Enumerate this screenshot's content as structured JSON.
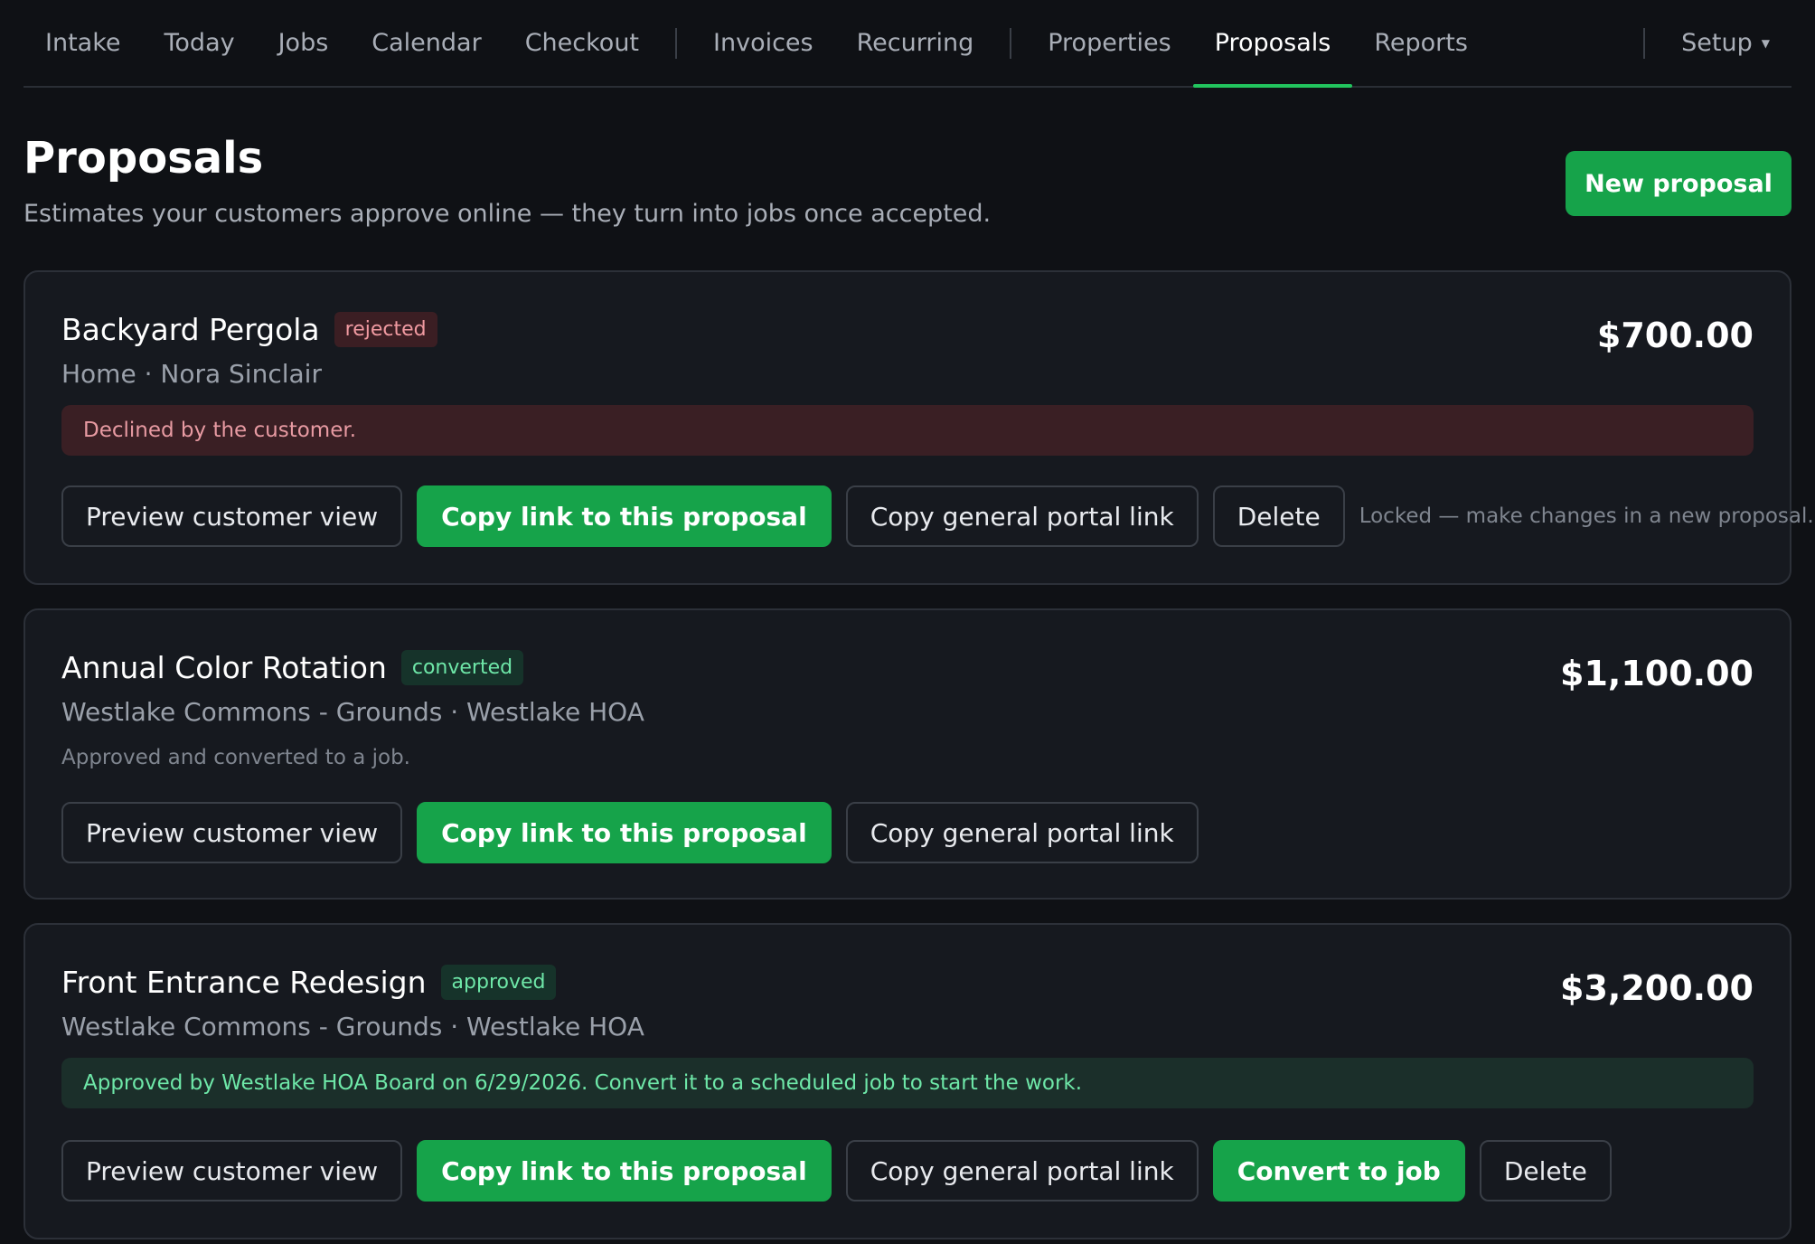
{
  "nav": {
    "items": [
      {
        "label": "Intake"
      },
      {
        "label": "Today"
      },
      {
        "label": "Jobs"
      },
      {
        "label": "Calendar"
      },
      {
        "label": "Checkout"
      },
      {
        "label": "Invoices"
      },
      {
        "label": "Recurring"
      },
      {
        "label": "Properties"
      },
      {
        "label": "Proposals",
        "active": true
      },
      {
        "label": "Reports"
      }
    ],
    "setup_label": "Setup",
    "accent_color": "#22c55e"
  },
  "header": {
    "title": "Proposals",
    "subtitle": "Estimates your customers approve online — they turn into jobs once accepted.",
    "new_button": "New proposal"
  },
  "proposals": [
    {
      "title": "Backyard Pergola",
      "status": "rejected",
      "amount": "$700.00",
      "subtitle": "Home · Nora Sinclair",
      "banner": "Declined by the customer.",
      "actions": {
        "preview": "Preview customer view",
        "copy_link": "Copy link to this proposal",
        "copy_portal": "Copy general portal link",
        "delete": "Delete"
      },
      "lock_note": "Locked — make changes in a new proposal."
    },
    {
      "title": "Annual Color Rotation",
      "status": "converted",
      "amount": "$1,100.00",
      "subtitle": "Westlake Commons - Grounds · Westlake HOA",
      "note": "Approved and converted to a job.",
      "actions": {
        "preview": "Preview customer view",
        "copy_link": "Copy link to this proposal",
        "copy_portal": "Copy general portal link"
      }
    },
    {
      "title": "Front Entrance Redesign",
      "status": "approved",
      "amount": "$3,200.00",
      "subtitle": "Westlake Commons - Grounds · Westlake HOA",
      "banner": "Approved by Westlake HOA Board on 6/29/2026. Convert it to a scheduled job to start the work.",
      "actions": {
        "preview": "Preview customer view",
        "copy_link": "Copy link to this proposal",
        "copy_portal": "Copy general portal link",
        "convert": "Convert to job",
        "delete": "Delete"
      }
    }
  ],
  "colors": {
    "background": "#0f1115",
    "card": "#16191f",
    "primary_green": "#16a34a",
    "rejected_badge": "#3b1e23",
    "approved_badge": "#16332a"
  }
}
